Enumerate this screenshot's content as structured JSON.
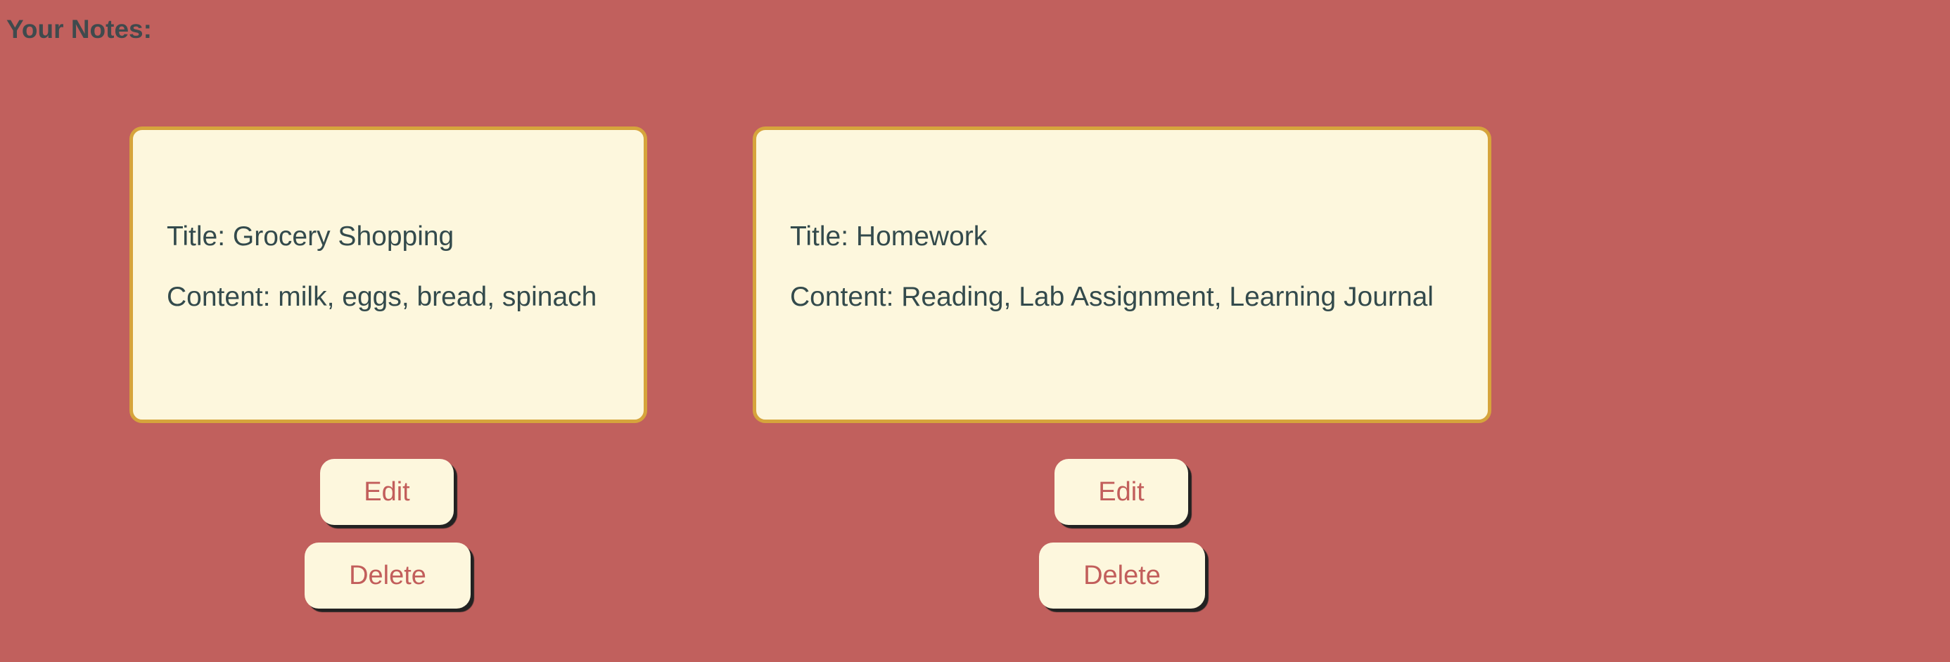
{
  "page": {
    "heading": "Your Notes:"
  },
  "notes": [
    {
      "title_label": "Title: Grocery Shopping",
      "content_label": "Content: milk, eggs, bread, spinach",
      "edit_label": "Edit",
      "delete_label": "Delete"
    },
    {
      "title_label": "Title: Homework",
      "content_label": "Content: Reading, Lab Assignment, Learning Journal",
      "edit_label": "Edit",
      "delete_label": "Delete"
    }
  ],
  "colors": {
    "background": "#c1605d",
    "card_background": "#fdf7dd",
    "card_border": "#d6a43c",
    "text": "#334a4c",
    "button_text": "#c25e5b"
  }
}
